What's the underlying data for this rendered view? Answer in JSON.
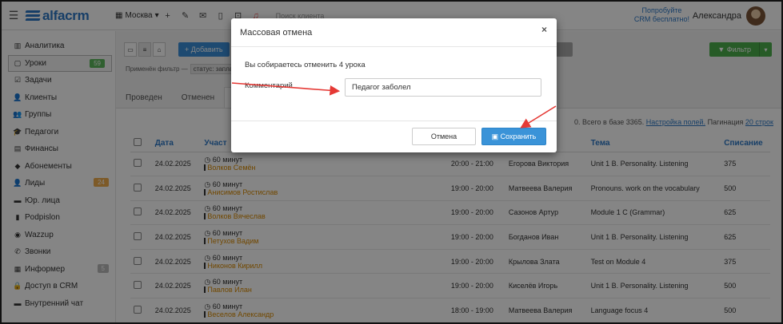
{
  "app": {
    "logo_text": "alfacrm",
    "branch": "Москва",
    "search_placeholder": "Поиск клиента",
    "promo_line1": "Попробуйте",
    "promo_line2": "CRM бесплатно!",
    "user_name": "Александра"
  },
  "sidebar": {
    "items": [
      {
        "label": "Аналитика",
        "icon": "chart-icon",
        "glyph": "▥"
      },
      {
        "label": "Уроки",
        "icon": "calendar-icon",
        "glyph": "▢",
        "badge": "59",
        "badge_color": "#5cb85c"
      },
      {
        "label": "Задачи",
        "icon": "tasks-icon",
        "glyph": "☑"
      },
      {
        "label": "Клиенты",
        "icon": "client-icon",
        "glyph": "👤"
      },
      {
        "label": "Группы",
        "icon": "group-icon",
        "glyph": "👥"
      },
      {
        "label": "Педагоги",
        "icon": "teacher-icon",
        "glyph": "🎓"
      },
      {
        "label": "Финансы",
        "icon": "finance-icon",
        "glyph": "▤"
      },
      {
        "label": "Абонементы",
        "icon": "tag-icon",
        "glyph": "◆"
      },
      {
        "label": "Лиды",
        "icon": "lead-icon",
        "glyph": "👤",
        "badge": "24",
        "badge_color": "#f0ad4e"
      },
      {
        "label": "Юр. лица",
        "icon": "briefcase-icon",
        "glyph": "▬"
      },
      {
        "label": "Podpislon",
        "icon": "document-icon",
        "glyph": "▮"
      },
      {
        "label": "Wazzup",
        "icon": "whatsapp-icon",
        "glyph": "◉"
      },
      {
        "label": "Звонки",
        "icon": "phone-icon",
        "glyph": "✆"
      },
      {
        "label": "Информер",
        "icon": "informer-icon",
        "glyph": "▦",
        "badge": "5",
        "badge_color": "#bbbbbb"
      },
      {
        "label": "Доступ в CRM",
        "icon": "lock-icon",
        "glyph": "🔒"
      },
      {
        "label": "Внутренний чат",
        "icon": "chat-icon",
        "glyph": "▬"
      }
    ]
  },
  "toolbar": {
    "add_label": "+ Добавить",
    "filter_label": "▼ Фильтр",
    "applied_prefix": "Применён фильтр —",
    "applied_chip": "статус: заплан"
  },
  "tabs": [
    {
      "label": "Проведен"
    },
    {
      "label": "Отменен"
    },
    {
      "label": "За"
    }
  ],
  "stats": {
    "total_text": "0. Всего в базе 3365.",
    "fields_link": "Настройка полей.",
    "pagination_label": "Пагинация",
    "pagination_link": "20 строк"
  },
  "table": {
    "headers": [
      "Дата",
      "Участ",
      "",
      "",
      "Тема",
      "Списание"
    ],
    "rows": [
      {
        "date": "24.02.2025",
        "duration": "60 минут",
        "student": "Волков Семён",
        "time": "20:00 - 21:00",
        "teacher": "Егорова Виктория",
        "topic": "Unit 1 B. Personality. Listening",
        "charge": "375"
      },
      {
        "date": "24.02.2025",
        "duration": "60 минут",
        "student": "Анисимов Ростислав",
        "time": "19:00 - 20:00",
        "teacher": "Матвеева Валерия",
        "topic": "Pronouns. work on the vocabulary",
        "charge": "500"
      },
      {
        "date": "24.02.2025",
        "duration": "60 минут",
        "student": "Волков Вячеслав",
        "time": "19:00 - 20:00",
        "teacher": "Сазонов Артур",
        "topic": "Module 1 C (Grammar)",
        "charge": "625"
      },
      {
        "date": "24.02.2025",
        "duration": "60 минут",
        "student": "Петухов Вадим",
        "time": "19:00 - 20:00",
        "teacher": "Богданов Иван",
        "topic": "Unit 1 B. Personality. Listening",
        "charge": "625"
      },
      {
        "date": "24.02.2025",
        "duration": "60 минут",
        "student": "Никонов Кирилл",
        "time": "19:00 - 20:00",
        "teacher": "Крылова Злата",
        "topic": "Test on Module 4",
        "charge": "375"
      },
      {
        "date": "24.02.2025",
        "duration": "60 минут",
        "student": "Павлов Илан",
        "time": "19:00 - 20:00",
        "teacher": "Киселёв Игорь",
        "topic": "Unit 1 B. Personality. Listening",
        "charge": "500"
      },
      {
        "date": "24.02.2025",
        "duration": "60 минут",
        "student": "Веселов Александр",
        "time": "18:00 - 19:00",
        "teacher": "Матвеева Валерия",
        "topic": "Language focus 4",
        "charge": "500"
      }
    ]
  },
  "modal": {
    "title": "Массовая отмена",
    "message": "Вы собираетесь отменить 4 урока",
    "comment_label": "Комментарий",
    "comment_value": "Педагог заболел",
    "cancel_label": "Отмена",
    "save_label": "Сохранить",
    "save_icon": "floppy-icon"
  },
  "colors": {
    "accent": "#2c78c6",
    "arrow": "#e53935",
    "student_link": "#d98a00"
  }
}
